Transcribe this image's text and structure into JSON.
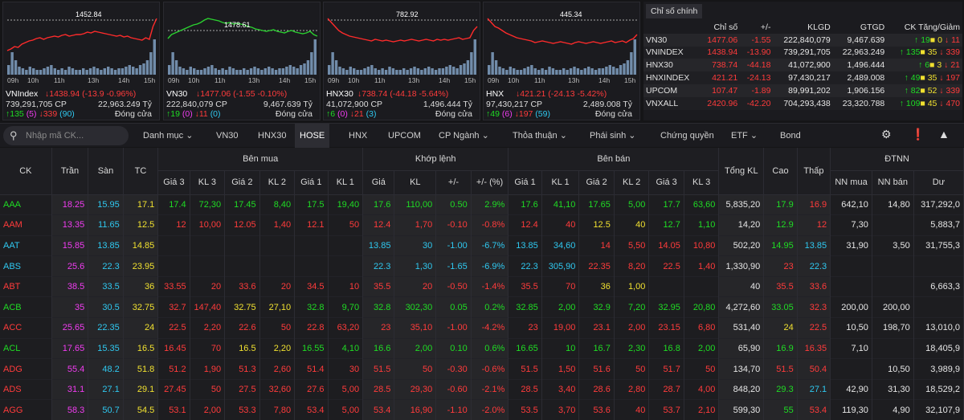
{
  "charts": [
    {
      "name": "VNIndex",
      "ref": "1452.84",
      "value": "↓1438.94 (-13.9 -0.96%)",
      "vol": "739,291,705 CP",
      "val": "22,963.249 Tỷ",
      "up": "↑135",
      "up_c": "(5)",
      "down": "↓339",
      "down_c": "(90)",
      "status": "Đóng cửa",
      "times": [
        "09h",
        "10h",
        "11h",
        "13h",
        "14h",
        "15h"
      ]
    },
    {
      "name": "VN30",
      "ref": "1478.61",
      "value": "↓1477.06 (-1.55 -0.10%)",
      "vol": "222,840,079 CP",
      "val": "9,467.639 Tỷ",
      "up": "↑19",
      "up_c": "(0)",
      "down": "↓11",
      "down_c": "(0)",
      "status": "Đóng cửa",
      "times": [
        "09h",
        "10h",
        "11h",
        "13h",
        "14h",
        "15h"
      ]
    },
    {
      "name": "HNX30",
      "ref": "782.92",
      "value": "↓738.74 (-44.18 -5.64%)",
      "vol": "41,072,900 CP",
      "val": "1,496.444 Tỷ",
      "up": "↑6",
      "up_c": "(0)",
      "down": "↓21",
      "down_c": "(3)",
      "status": "Đóng cửa",
      "times": [
        "09h",
        "10h",
        "11h",
        "13h",
        "14h",
        "15h"
      ]
    },
    {
      "name": "HNX",
      "ref": "445.34",
      "value": "↓421.21 (-24.13 -5.42%)",
      "vol": "97,430,217 CP",
      "val": "2,489.008 Tỷ",
      "up": "↑49",
      "up_c": "(6)",
      "down": "↓197",
      "down_c": "(59)",
      "status": "Đóng cửa",
      "times": [
        "09h",
        "10h",
        "11h",
        "13h",
        "14h",
        "15h"
      ]
    }
  ],
  "summary": {
    "tab": "Chỉ số chính",
    "headers": [
      "",
      "Chỉ số",
      "+/-",
      "KLGD",
      "GTGD",
      "CK Tăng/Giảm"
    ],
    "rows": [
      {
        "n": "VN30",
        "v": "1477.06",
        "c": "-1.55",
        "kl": "222,840,079",
        "gt": "9,467.639",
        "u": "↑ 19",
        "e": "0",
        "d": "↓ 11",
        "dc": "red",
        "vc": "red"
      },
      {
        "n": "VNINDEX",
        "v": "1438.94",
        "c": "-13.90",
        "kl": "739,291,705",
        "gt": "22,963.249",
        "u": "↑ 135",
        "e": "35",
        "d": "↓ 339",
        "dc": "red",
        "vc": "red"
      },
      {
        "n": "HNX30",
        "v": "738.74",
        "c": "-44.18",
        "kl": "41,072,900",
        "gt": "1,496.444",
        "u": "↑ 6",
        "e": "3",
        "d": "↓ 21",
        "dc": "red",
        "vc": "red"
      },
      {
        "n": "HNXINDEX",
        "v": "421.21",
        "c": "-24.13",
        "kl": "97,430,217",
        "gt": "2,489.008",
        "u": "↑ 49",
        "e": "35",
        "d": "↓ 197",
        "dc": "red",
        "vc": "red"
      },
      {
        "n": "UPCOM",
        "v": "107.47",
        "c": "-1.89",
        "kl": "89,991,202",
        "gt": "1,906.156",
        "u": "↑ 82",
        "e": "52",
        "d": "↓ 339",
        "dc": "red",
        "vc": "red"
      },
      {
        "n": "VNXALL",
        "v": "2420.96",
        "c": "-42.20",
        "kl": "704,293,438",
        "gt": "23,320.788",
        "u": "↑ 109",
        "e": "45",
        "d": "↓ 470",
        "dc": "red",
        "vc": "red"
      }
    ]
  },
  "toolbar": {
    "search_placeholder": "Nhập mã CK...",
    "tabs": [
      "Danh mục",
      "VN30",
      "HNX30",
      "HOSE",
      "HNX",
      "UPCOM",
      "CP Ngành",
      "Thỏa thuận",
      "Phái sinh",
      "Chứng quyền",
      "ETF",
      "Bond"
    ]
  },
  "grid": {
    "h_ck": "CK",
    "h_tran": "Trần",
    "h_san": "Sàn",
    "h_tc": "TC",
    "g_mua": "Bên mua",
    "g_khop": "Khớp lệnh",
    "g_ban": "Bên bán",
    "h_tkl": "Tổng KL",
    "h_cao": "Cao",
    "h_thap": "Thấp",
    "g_dtnn": "ĐTNN",
    "sub": [
      "Giá 3",
      "KL 3",
      "Giá 2",
      "KL 2",
      "Giá 1",
      "KL 1",
      "Giá",
      "KL",
      "+/-",
      "+/- (%)",
      "Giá 1",
      "KL 1",
      "Giá 2",
      "KL 2",
      "Giá 3",
      "KL 3",
      "NN mua",
      "NN bán",
      "Dư"
    ],
    "rows": [
      [
        "AAA",
        "18.25",
        "15.95",
        "17.1",
        "17.4",
        "72,30",
        "17.45",
        "8,40",
        "17.5",
        "19,40",
        "17.6",
        "110,00",
        "0.50",
        "2.9%",
        "17.6",
        "41,10",
        "17.65",
        "5,00",
        "17.7",
        "63,60",
        "5,835,20",
        "17.9",
        "16.9",
        "642,10",
        "14,80",
        "317,292,0"
      ],
      [
        "AAM",
        "13.35",
        "11.65",
        "12.5",
        "12",
        "10,00",
        "12.05",
        "1,40",
        "12.1",
        "50",
        "12.4",
        "1,70",
        "-0.10",
        "-0.8%",
        "12.4",
        "40",
        "12.5",
        "40",
        "12.7",
        "1,10",
        "14,20",
        "12.9",
        "12",
        "7,30",
        "",
        "5,883,7"
      ],
      [
        "AAT",
        "15.85",
        "13.85",
        "14.85",
        "",
        "",
        "",
        "",
        "",
        "",
        "13.85",
        "30",
        "-1.00",
        "-6.7%",
        "13.85",
        "34,60",
        "14",
        "5,50",
        "14.05",
        "10,80",
        "502,20",
        "14.95",
        "13.85",
        "31,90",
        "3,50",
        "31,755,3"
      ],
      [
        "ABS",
        "25.6",
        "22.3",
        "23.95",
        "",
        "",
        "",
        "",
        "",
        "",
        "22.3",
        "1,30",
        "-1.65",
        "-6.9%",
        "22.3",
        "305,90",
        "22.35",
        "8,20",
        "22.5",
        "1,40",
        "1,330,90",
        "23",
        "22.3",
        "",
        "",
        ""
      ],
      [
        "ABT",
        "38.5",
        "33.5",
        "36",
        "33.55",
        "20",
        "33.6",
        "20",
        "34.5",
        "10",
        "35.5",
        "20",
        "-0.50",
        "-1.4%",
        "35.5",
        "70",
        "36",
        "1,00",
        "",
        "",
        "40",
        "35.5",
        "33.6",
        "",
        "",
        "6,663,3"
      ],
      [
        "ACB",
        "35",
        "30.5",
        "32.75",
        "32.7",
        "147,40",
        "32.75",
        "27,10",
        "32.8",
        "9,70",
        "32.8",
        "302,30",
        "0.05",
        "0.2%",
        "32.85",
        "2,00",
        "32.9",
        "7,20",
        "32.95",
        "20,80",
        "4,272,60",
        "33.05",
        "32.3",
        "200,00",
        "200,00",
        ""
      ],
      [
        "ACC",
        "25.65",
        "22.35",
        "24",
        "22.5",
        "2,20",
        "22.6",
        "50",
        "22.8",
        "63,20",
        "23",
        "35,10",
        "-1.00",
        "-4.2%",
        "23",
        "19,00",
        "23.1",
        "2,00",
        "23.15",
        "6,80",
        "531,40",
        "24",
        "22.5",
        "10,50",
        "198,70",
        "13,010,0"
      ],
      [
        "ACL",
        "17.65",
        "15.35",
        "16.5",
        "16.45",
        "70",
        "16.5",
        "2,20",
        "16.55",
        "4,10",
        "16.6",
        "2,00",
        "0.10",
        "0.6%",
        "16.65",
        "10",
        "16.7",
        "2,30",
        "16.8",
        "2,00",
        "65,90",
        "16.9",
        "16.35",
        "7,10",
        "",
        "18,405,9"
      ],
      [
        "ADG",
        "55.4",
        "48.2",
        "51.8",
        "51.2",
        "1,90",
        "51.3",
        "2,60",
        "51.4",
        "30",
        "51.5",
        "50",
        "-0.30",
        "-0.6%",
        "51.5",
        "1,50",
        "51.6",
        "50",
        "51.7",
        "50",
        "134,70",
        "51.5",
        "50.4",
        "",
        "10,50",
        "3,989,9"
      ],
      [
        "ADS",
        "31.1",
        "27.1",
        "29.1",
        "27.45",
        "50",
        "27.5",
        "32,60",
        "27.6",
        "5,00",
        "28.5",
        "29,30",
        "-0.60",
        "-2.1%",
        "28.5",
        "3,40",
        "28.6",
        "2,80",
        "28.7",
        "4,00",
        "848,20",
        "29.3",
        "27.1",
        "42,90",
        "31,30",
        "18,529,2"
      ],
      [
        "AGG",
        "58.3",
        "50.7",
        "54.5",
        "53.1",
        "2,00",
        "53.3",
        "7,80",
        "53.4",
        "5,00",
        "53.4",
        "16,90",
        "-1.10",
        "-2.0%",
        "53.5",
        "3,70",
        "53.6",
        "40",
        "53.7",
        "2,10",
        "599,30",
        "55",
        "53.4",
        "119,30",
        "4,90",
        "32,107,9"
      ]
    ]
  }
}
